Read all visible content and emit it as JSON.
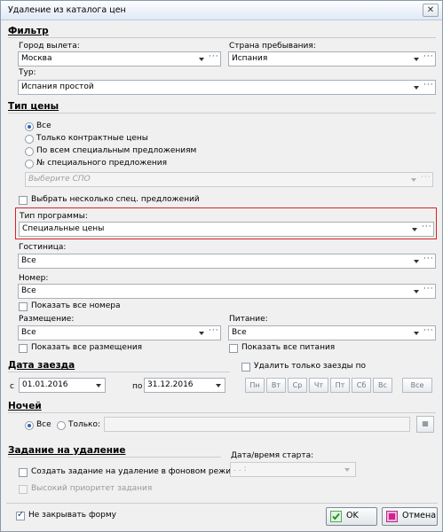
{
  "window": {
    "title": "Удаление из каталога цен",
    "close": "✕"
  },
  "filter": {
    "heading": "Фильтр",
    "city_label": "Город вылета:",
    "city_value": "Москва",
    "country_label": "Страна пребывания:",
    "country_value": "Испания",
    "tour_label": "Тур:",
    "tour_value": "Испания простой"
  },
  "price_type": {
    "heading": "Тип цены",
    "options": [
      "Все",
      "Только контрактные цены",
      "По всем специальным предложениям",
      "№ специального предложения"
    ],
    "spo_placeholder": "Выберите СПО",
    "multi_spo_label": "Выбрать несколько спец. предложений",
    "program_label": "Тип программы:",
    "program_value": "Специальные цены",
    "hotel_label": "Гостиница:",
    "hotel_value": "Все",
    "room_label": "Номер:",
    "room_value": "Все",
    "show_rooms": "Показать все номера",
    "accom_label": "Размещение:",
    "accom_value": "Все",
    "meal_label": "Питание:",
    "meal_value": "Все",
    "show_accom": "Показать все размещения",
    "show_meals": "Показать все питания"
  },
  "arrival": {
    "heading": "Дата заезда",
    "from_label": "с",
    "from_value": "01.01.2016",
    "to_label": "по",
    "to_value": "31.12.2016",
    "only_label": "Удалить только заезды по",
    "days": [
      "Пн",
      "Вт",
      "Ср",
      "Чт",
      "Пт",
      "Сб",
      "Вс"
    ],
    "all_days": "Все"
  },
  "nights": {
    "heading": "Ночей",
    "all_label": "Все",
    "only_label": "Только:"
  },
  "task": {
    "heading": "Задание на удаление",
    "create_label": "Создать задание на удаление в фоновом режиме",
    "priority_label": "Высокий приоритет задания",
    "start_label": "Дата/время старта:",
    "start_value": "  .  .      :"
  },
  "footer": {
    "keep_open": "Не закрывать форму",
    "ok": "OK",
    "cancel": "Отмена"
  }
}
